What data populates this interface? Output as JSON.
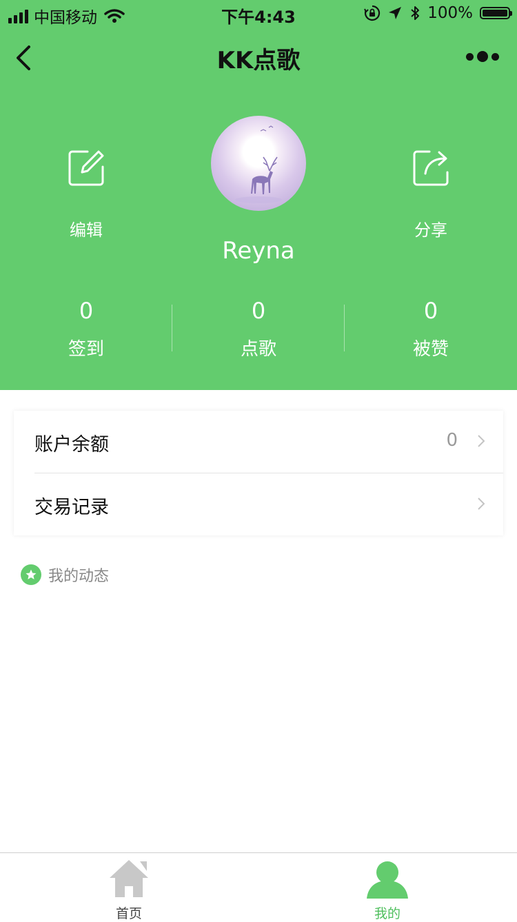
{
  "status_bar": {
    "carrier": "中国移动",
    "time": "下午4:43",
    "battery": "100%"
  },
  "nav": {
    "title": "KK点歌"
  },
  "profile": {
    "edit_label": "编辑",
    "share_label": "分享",
    "username": "Reyna",
    "stats": [
      {
        "value": "0",
        "label": "签到"
      },
      {
        "value": "0",
        "label": "点歌"
      },
      {
        "value": "0",
        "label": "被赞"
      }
    ]
  },
  "menu": {
    "balance_label": "账户余额",
    "balance_value": "0",
    "transactions_label": "交易记录"
  },
  "feed": {
    "title": "我的动态"
  },
  "tabbar": {
    "home_label": "首页",
    "mine_label": "我的"
  },
  "colors": {
    "accent": "#63cc6e",
    "active_tab": "#4fbf5d",
    "inactive_tab_icon": "#c8c8c8"
  }
}
